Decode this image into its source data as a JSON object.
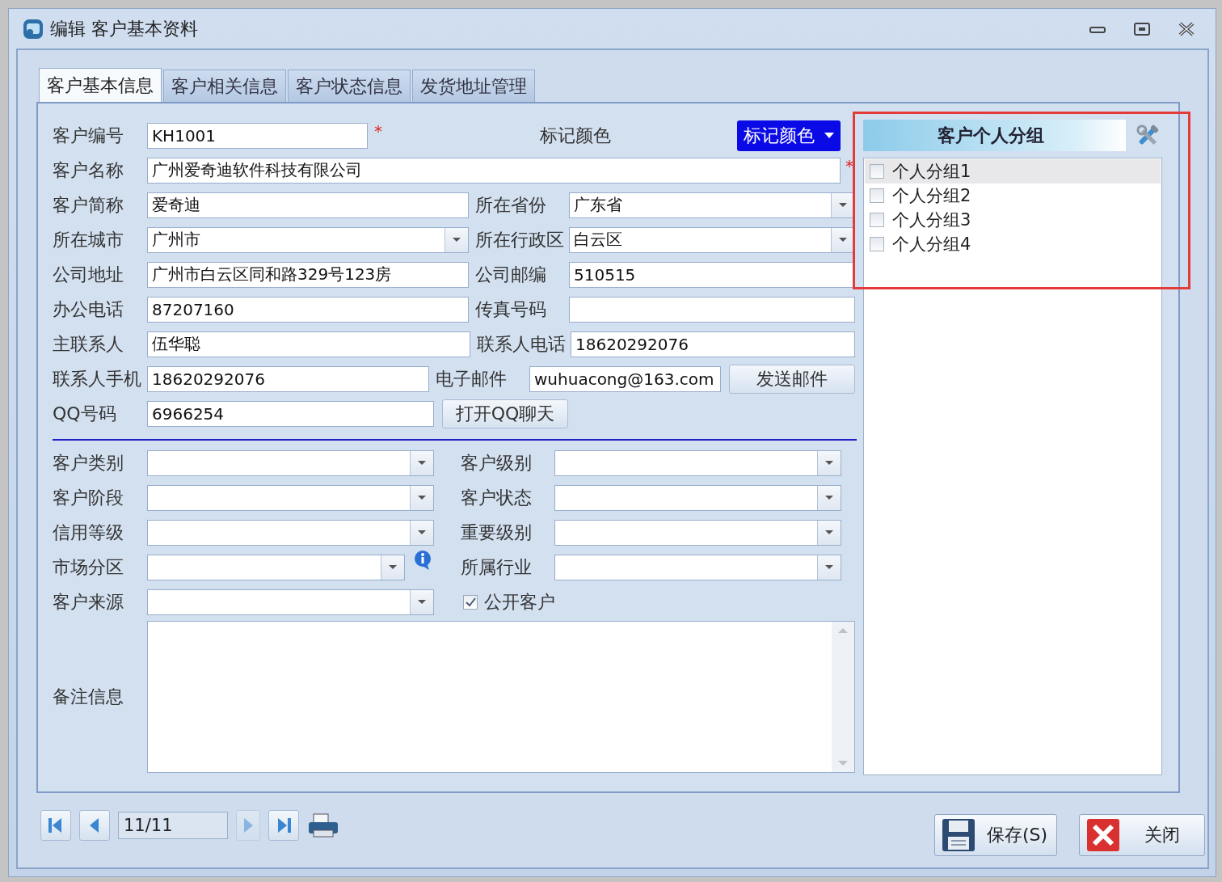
{
  "window": {
    "title": "编辑 客户基本资料"
  },
  "tabs": [
    {
      "label": "客户基本信息",
      "selected": true
    },
    {
      "label": "客户相关信息",
      "selected": false
    },
    {
      "label": "客户状态信息",
      "selected": false
    },
    {
      "label": "发货地址管理",
      "selected": false
    }
  ],
  "form": {
    "rows": [
      [
        {
          "kind": "label",
          "text": "客户编号"
        },
        {
          "kind": "input",
          "value": "KH1001"
        },
        {
          "kind": "required",
          "text": "*"
        },
        {
          "kind": "label",
          "text": "标记颜色"
        },
        {
          "kind": "color_button",
          "text": "标记颜色",
          "color": "#0a0ae6"
        }
      ],
      [
        {
          "kind": "label",
          "text": "客户名称"
        },
        {
          "kind": "input",
          "value": "广州爱奇迪软件科技有限公司"
        },
        {
          "kind": "required",
          "text": "*"
        }
      ],
      [
        {
          "kind": "label",
          "text": "客户简称"
        },
        {
          "kind": "input",
          "value": "爱奇迪"
        },
        {
          "kind": "label",
          "text": "所在省份"
        },
        {
          "kind": "combo",
          "value": "广东省"
        }
      ],
      [
        {
          "kind": "label",
          "text": "所在城市"
        },
        {
          "kind": "combo",
          "value": "广州市"
        },
        {
          "kind": "label",
          "text": "所在行政区"
        },
        {
          "kind": "combo",
          "value": "白云区"
        }
      ],
      [
        {
          "kind": "label",
          "text": "公司地址"
        },
        {
          "kind": "input",
          "value": "广州市白云区同和路329号123房"
        },
        {
          "kind": "label",
          "text": "公司邮编"
        },
        {
          "kind": "input",
          "value": "510515"
        }
      ],
      [
        {
          "kind": "label",
          "text": "办公电话"
        },
        {
          "kind": "input",
          "value": "87207160"
        },
        {
          "kind": "label",
          "text": "传真号码"
        },
        {
          "kind": "input"
        }
      ],
      [
        {
          "kind": "label",
          "text": "主联系人"
        },
        {
          "kind": "input",
          "value": "伍华聪"
        },
        {
          "kind": "label",
          "text": "联系人电话"
        },
        {
          "kind": "input",
          "value": "18620292076"
        }
      ],
      [
        {
          "kind": "label",
          "text": "联系人手机"
        },
        {
          "kind": "input",
          "value": "18620292076"
        },
        {
          "kind": "label",
          "text": "电子邮件"
        },
        {
          "kind": "input",
          "value": "wuhuacong@163.com"
        },
        {
          "kind": "button",
          "text": "发送邮件"
        }
      ],
      [
        {
          "kind": "label",
          "text": "QQ号码"
        },
        {
          "kind": "input",
          "value": "6966254"
        },
        {
          "kind": "button",
          "text": "打开QQ聊天"
        }
      ]
    ],
    "lower_rows": [
      [
        {
          "kind": "label",
          "text": "客户类别"
        },
        {
          "kind": "combo"
        },
        {
          "kind": "label",
          "text": "客户级别"
        },
        {
          "kind": "combo"
        }
      ],
      [
        {
          "kind": "label",
          "text": "客户阶段"
        },
        {
          "kind": "combo"
        },
        {
          "kind": "label",
          "text": "客户状态"
        },
        {
          "kind": "combo"
        }
      ],
      [
        {
          "kind": "label",
          "text": "信用等级"
        },
        {
          "kind": "combo"
        },
        {
          "kind": "label",
          "text": "重要级别"
        },
        {
          "kind": "combo"
        }
      ],
      [
        {
          "kind": "label",
          "text": "市场分区"
        },
        {
          "kind": "combo"
        },
        {
          "kind": "info"
        },
        {
          "kind": "label",
          "text": "所属行业"
        },
        {
          "kind": "combo"
        }
      ],
      [
        {
          "kind": "label",
          "text": "客户来源"
        },
        {
          "kind": "combo"
        },
        {
          "kind": "checkbox",
          "text": "公开客户",
          "checked": true
        }
      ]
    ],
    "remarks": {
      "label": "备注信息"
    }
  },
  "group_panel": {
    "title": "客户个人分组",
    "items": [
      {
        "label": "个人分组1",
        "checked": false,
        "selected": true
      },
      {
        "label": "个人分组2",
        "checked": false,
        "selected": false
      },
      {
        "label": "个人分组3",
        "checked": false,
        "selected": false
      },
      {
        "label": "个人分组4",
        "checked": false,
        "selected": false
      }
    ]
  },
  "navigator": {
    "position": "11/11",
    "buttons": [
      {
        "kind": "first",
        "disabled": false
      },
      {
        "kind": "prev",
        "disabled": false
      },
      {
        "kind": "next",
        "disabled": true
      },
      {
        "kind": "last",
        "disabled": false
      }
    ]
  },
  "buttons": [
    {
      "kind": "save",
      "label": "保存(S)"
    },
    {
      "kind": "close",
      "label": "关闭"
    }
  ]
}
